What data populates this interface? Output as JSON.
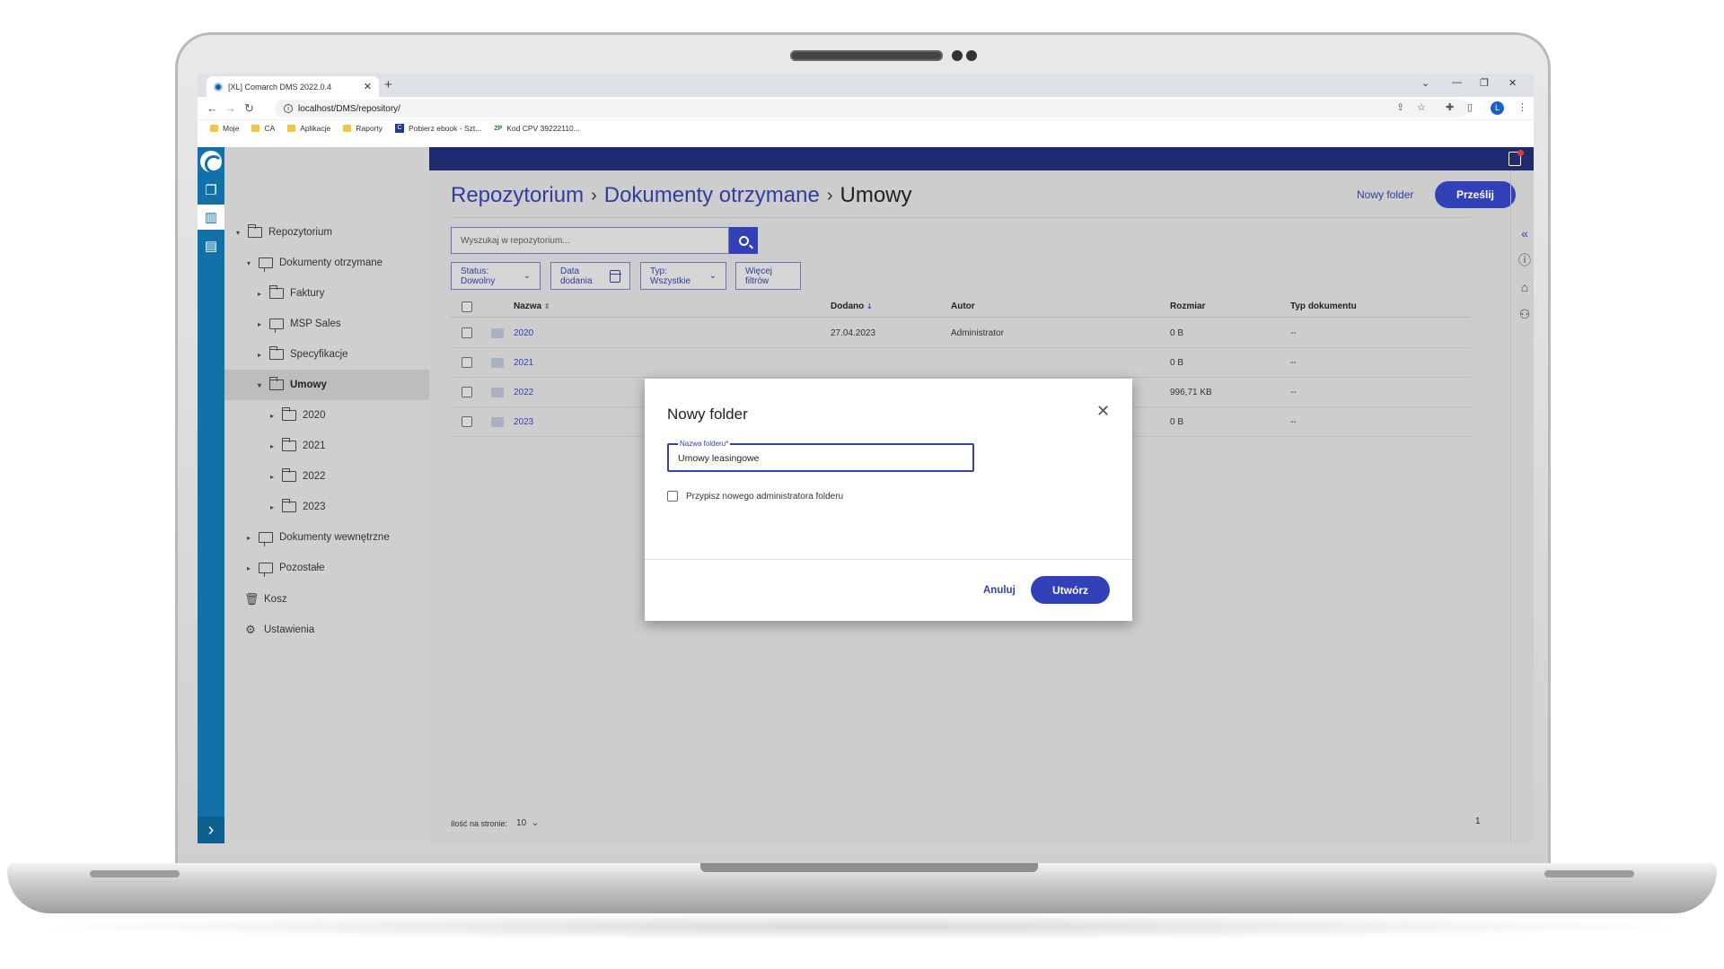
{
  "browser": {
    "tab_title": "[XL] Comarch DMS 2022.0.4",
    "url": "localhost/DMS/repository/",
    "profile_initial": "L",
    "bookmarks": [
      {
        "label": "Moje",
        "icon": "folder-icon"
      },
      {
        "label": "CA",
        "icon": "folder-icon"
      },
      {
        "label": "Aplikacje",
        "icon": "folder-icon"
      },
      {
        "label": "Raporty",
        "icon": "folder-icon"
      },
      {
        "label": "Pobierz ebook - Szt...",
        "icon": "c-site-icon"
      },
      {
        "label": "Kod CPV 39222110...",
        "icon": "zp-site-icon"
      }
    ]
  },
  "sidebar": {
    "items": [
      {
        "label": "Repozytorium",
        "caret": "▾",
        "icon": "open-folder-icon",
        "level": 0
      },
      {
        "label": "Dokumenty otrzymane",
        "caret": "▾",
        "icon": "monitor-folder-icon",
        "level": 1
      },
      {
        "label": "Faktury",
        "caret": "▸",
        "icon": "folder-icon",
        "level": 2
      },
      {
        "label": "MSP Sales",
        "caret": "▸",
        "icon": "monitor-folder-icon",
        "level": 2
      },
      {
        "label": "Specyfikacje",
        "caret": "▸",
        "icon": "folder-icon",
        "level": 2
      },
      {
        "label": "Umowy",
        "caret": "▾",
        "icon": "open-folder-icon",
        "level": 2,
        "selected": true
      },
      {
        "label": "2020",
        "caret": "▸",
        "icon": "folder-icon",
        "level": 3
      },
      {
        "label": "2021",
        "caret": "▸",
        "icon": "folder-icon",
        "level": 3
      },
      {
        "label": "2022",
        "caret": "▸",
        "icon": "folder-icon",
        "level": 3
      },
      {
        "label": "2023",
        "caret": "▸",
        "icon": "folder-icon",
        "level": 3
      },
      {
        "label": "Dokumenty wewnętrzne",
        "caret": "▸",
        "icon": "monitor-folder-icon",
        "level": 1
      },
      {
        "label": "Pozostałe",
        "caret": "▸",
        "icon": "monitor-folder-icon",
        "level": 1
      }
    ],
    "bin_label": "Kosz",
    "settings_label": "Ustawienia"
  },
  "header": {
    "breadcrumb": [
      "Repozytorium",
      "Dokumenty otrzymane",
      "Umowy"
    ],
    "new_folder_label": "Nowy folder",
    "upload_label": "Prześlij"
  },
  "toolbar": {
    "search_placeholder": "Wyszukaj w repozytorium...",
    "filter_status": "Status: Dowolny",
    "filter_date": "Data dodania",
    "filter_type": "Typ: Wszystkie",
    "more_filters": "Więcej filtrów"
  },
  "table": {
    "columns": [
      "Nazwa",
      "Dodano",
      "Autor",
      "Rozmiar",
      "Typ dokumentu"
    ],
    "rows": [
      {
        "name": "2020",
        "added": "27.04.2023",
        "author": "Administrator",
        "size": "0 B",
        "type": "--"
      },
      {
        "name": "2021",
        "added": "",
        "author": "",
        "size": "0 B",
        "type": "--"
      },
      {
        "name": "2022",
        "added": "",
        "author": "",
        "size": "996,71 KB",
        "type": "--"
      },
      {
        "name": "2023",
        "added": "",
        "author": "",
        "size": "0 B",
        "type": "--"
      }
    ]
  },
  "pager": {
    "label": "Ilość na stronie:",
    "page_size": "10",
    "page": "1"
  },
  "modal": {
    "title": "Nowy folder",
    "field_label": "Nazwa folderu*",
    "field_value": "Umowy leasingowe",
    "checkbox_label": "Przypisz nowego administratora folderu",
    "cancel_label": "Anuluj",
    "create_label": "Utwórz"
  },
  "colors": {
    "accent": "#3341b8",
    "rail": "#1171a8",
    "topbar": "#1f2a6f"
  }
}
